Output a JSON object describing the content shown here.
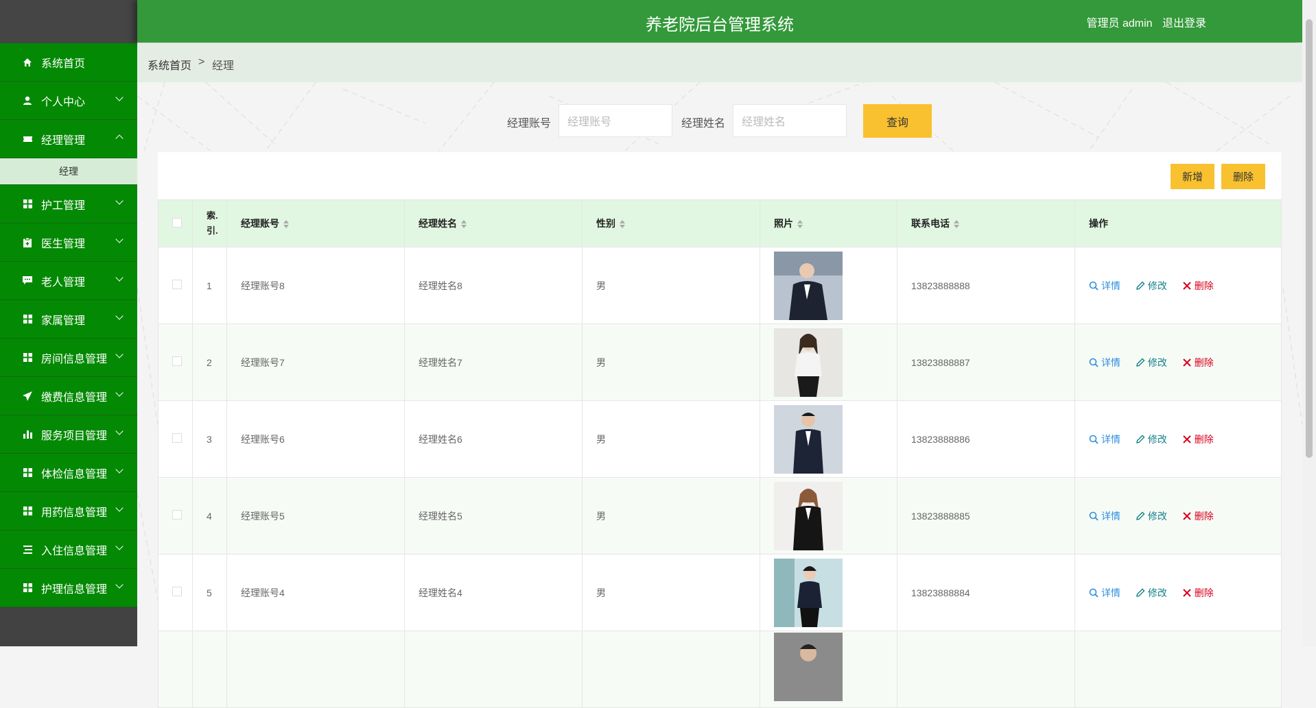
{
  "header": {
    "title": "养老院后台管理系统",
    "user": "管理员 admin",
    "logout": "退出登录"
  },
  "sidebar": {
    "items": [
      {
        "label": "系统首页",
        "icon": "home-icon"
      },
      {
        "label": "个人中心",
        "icon": "user-icon"
      },
      {
        "label": "经理管理",
        "icon": "ticket-icon",
        "expanded": true
      },
      {
        "label": "护工管理",
        "icon": "grid-icon"
      },
      {
        "label": "医生管理",
        "icon": "clipboard-icon"
      },
      {
        "label": "老人管理",
        "icon": "chat-icon"
      },
      {
        "label": "家属管理",
        "icon": "grid-icon"
      },
      {
        "label": "房间信息管理",
        "icon": "grid-icon"
      },
      {
        "label": "缴费信息管理",
        "icon": "send-icon"
      },
      {
        "label": "服务项目管理",
        "icon": "bar-chart-icon"
      },
      {
        "label": "体检信息管理",
        "icon": "grid-icon"
      },
      {
        "label": "用药信息管理",
        "icon": "grid-icon"
      },
      {
        "label": "入住信息管理",
        "icon": "list-icon"
      },
      {
        "label": "护理信息管理",
        "icon": "grid-icon"
      }
    ],
    "sub_item": "经理"
  },
  "breadcrumb": {
    "home": "系统首页",
    "separator": ">",
    "current": "经理"
  },
  "search": {
    "account_label": "经理账号",
    "account_placeholder": "经理账号",
    "name_label": "经理姓名",
    "name_placeholder": "经理姓名",
    "query": "查询"
  },
  "toolbar": {
    "add": "新增",
    "delete": "删除"
  },
  "table": {
    "headers": [
      "索引",
      "经理账号",
      "经理姓名",
      "性别",
      "照片",
      "联系电话",
      "操作"
    ],
    "index_header": "索.\n引.",
    "rows": [
      {
        "index": "1",
        "account": "经理账号8",
        "name": "经理姓名8",
        "gender": "男",
        "phone": "13823888888"
      },
      {
        "index": "2",
        "account": "经理账号7",
        "name": "经理姓名7",
        "gender": "男",
        "phone": "13823888887"
      },
      {
        "index": "3",
        "account": "经理账号6",
        "name": "经理姓名6",
        "gender": "男",
        "phone": "13823888886"
      },
      {
        "index": "4",
        "account": "经理账号5",
        "name": "经理姓名5",
        "gender": "男",
        "phone": "13823888885"
      },
      {
        "index": "5",
        "account": "经理账号4",
        "name": "经理姓名4",
        "gender": "男",
        "phone": "13823888884"
      }
    ],
    "actions": {
      "detail": "详情",
      "edit": "修改",
      "remove": "删除"
    }
  },
  "colors": {
    "header": "#33993a",
    "sidebar": "#048904",
    "accent": "#f9c12f"
  }
}
